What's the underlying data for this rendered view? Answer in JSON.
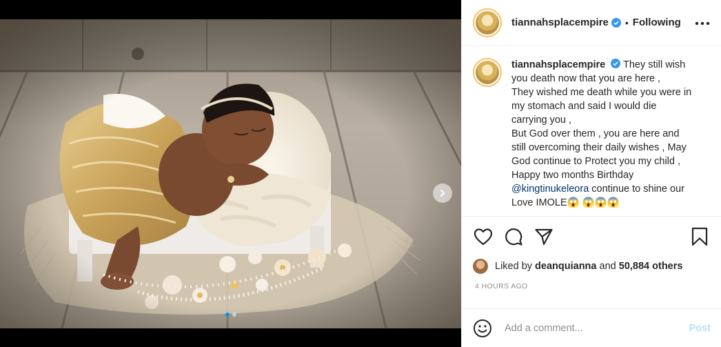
{
  "post": {
    "username": "tiannahsplacempire",
    "header_username": "tiannahsplacempire",
    "separator": "•",
    "follow_status": "Following",
    "verified": true
  },
  "caption": {
    "username": "tiannahsplacempire",
    "lines": [
      "They still wish",
      "you death now that you are here ,",
      "They wished me death while you were in",
      "my stomach and said I would die",
      "carrying you ,",
      "But God over them , you are here and",
      "still overcoming their daily wishes , May",
      "God continue to Protect you my child ,",
      "Happy two months Birthday"
    ],
    "mention": "@kingtinukeleora",
    "after_mention": " continue to shine our",
    "last_line": "Love IMOLE😱 😱😱😱"
  },
  "likes": {
    "prefix": "Liked by ",
    "liker": "deanquianna",
    "middle": " and ",
    "others": "50,884 others"
  },
  "timestamp": "4 HOURS AGO",
  "comment": {
    "placeholder": "Add a comment...",
    "post_label": "Post"
  },
  "carousel": {
    "count": 2,
    "active_index": 0
  },
  "colors": {
    "accent_blue": "#0095f6",
    "post_disabled": "#b2dffc",
    "verified_blue": "#3897f0",
    "secondary_text": "#8e8e8e",
    "mention": "#00376b"
  },
  "icons": {
    "header_more": "more-horizontal-icon",
    "like": "heart-icon",
    "comment": "comment-icon",
    "share": "paper-plane-icon",
    "save": "bookmark-icon",
    "emoji": "smiley-icon",
    "carousel_next": "chevron-right-icon",
    "verified": "verified-badge-icon"
  }
}
